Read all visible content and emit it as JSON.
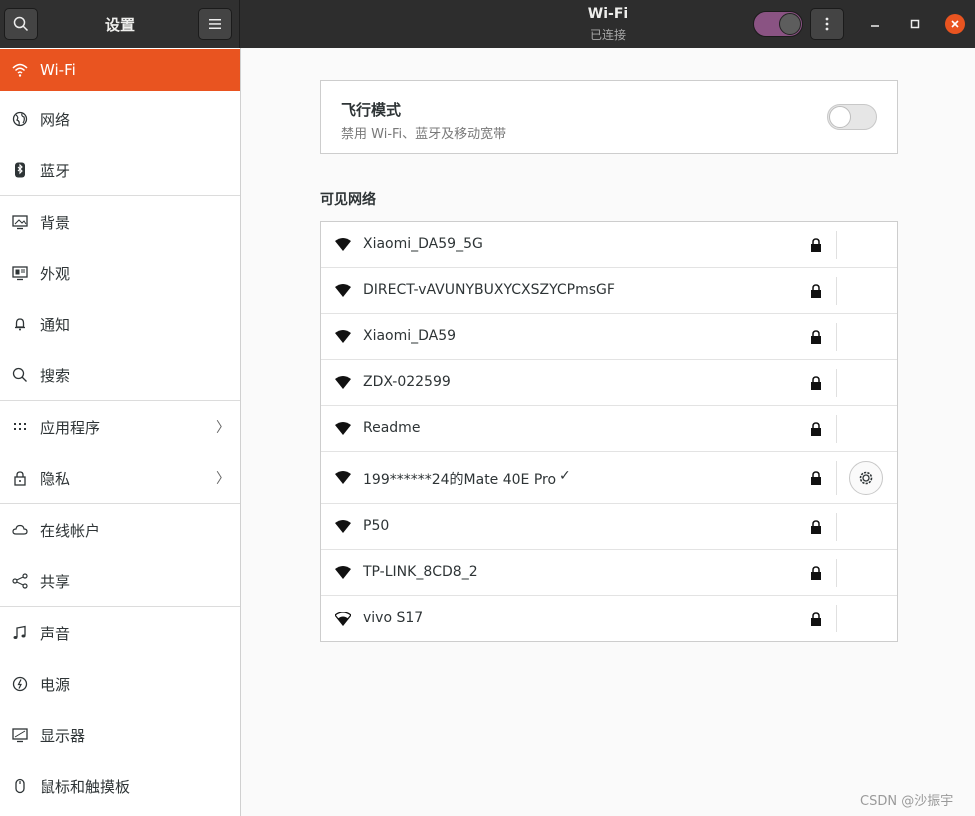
{
  "sidebar_header": {
    "title": "设置"
  },
  "header": {
    "title": "Wi-Fi",
    "subtitle": "已连接"
  },
  "sidebar": {
    "items": [
      {
        "label": "Wi-Fi",
        "icon": "wifi-icon",
        "active": true
      },
      {
        "label": "网络",
        "icon": "globe-icon"
      },
      {
        "label": "蓝牙",
        "icon": "bluetooth-icon"
      },
      {
        "label": "背景",
        "icon": "monitor-background-icon"
      },
      {
        "label": "外观",
        "icon": "appearance-icon"
      },
      {
        "label": "通知",
        "icon": "bell-icon"
      },
      {
        "label": "搜索",
        "icon": "search-icon"
      },
      {
        "label": "应用程序",
        "icon": "apps-grid-icon",
        "arrow": true
      },
      {
        "label": "隐私",
        "icon": "lock-icon",
        "arrow": true
      },
      {
        "label": "在线帐户",
        "icon": "cloud-icon"
      },
      {
        "label": "共享",
        "icon": "share-icon"
      },
      {
        "label": "声音",
        "icon": "music-note-icon"
      },
      {
        "label": "电源",
        "icon": "power-icon"
      },
      {
        "label": "显示器",
        "icon": "display-icon"
      },
      {
        "label": "鼠标和触摸板",
        "icon": "mouse-icon"
      }
    ]
  },
  "airplane": {
    "title": "飞行模式",
    "subtitle": "禁用 Wi-Fi、蓝牙及移动宽带",
    "enabled": false
  },
  "networks_title": "可见网络",
  "networks": [
    {
      "name": "Xiaomi_DA59_5G",
      "secured": true,
      "connected": false,
      "signal": "strong"
    },
    {
      "name": "DIRECT-vAVUNYBUXYCXSZYCPmsGF",
      "secured": true,
      "connected": false,
      "signal": "strong"
    },
    {
      "name": "Xiaomi_DA59",
      "secured": true,
      "connected": false,
      "signal": "strong"
    },
    {
      "name": "ZDX-022599",
      "secured": true,
      "connected": false,
      "signal": "strong"
    },
    {
      "name": "Readme",
      "secured": true,
      "connected": false,
      "signal": "strong"
    },
    {
      "name": "199******24的Mate 40E Pro",
      "secured": true,
      "connected": true,
      "check": "✓",
      "signal": "strong"
    },
    {
      "name": "P50",
      "secured": true,
      "connected": false,
      "signal": "strong"
    },
    {
      "name": "TP-LINK_8CD8_2",
      "secured": true,
      "connected": false,
      "signal": "strong"
    },
    {
      "name": "vivo S17",
      "secured": true,
      "connected": false,
      "signal": "medium"
    }
  ],
  "wifi_enabled": true,
  "colors": {
    "accent": "#e95420",
    "toggle_on": "#8a5383",
    "header_bg": "#2d2d2d"
  },
  "watermark": "CSDN @沙振宇"
}
